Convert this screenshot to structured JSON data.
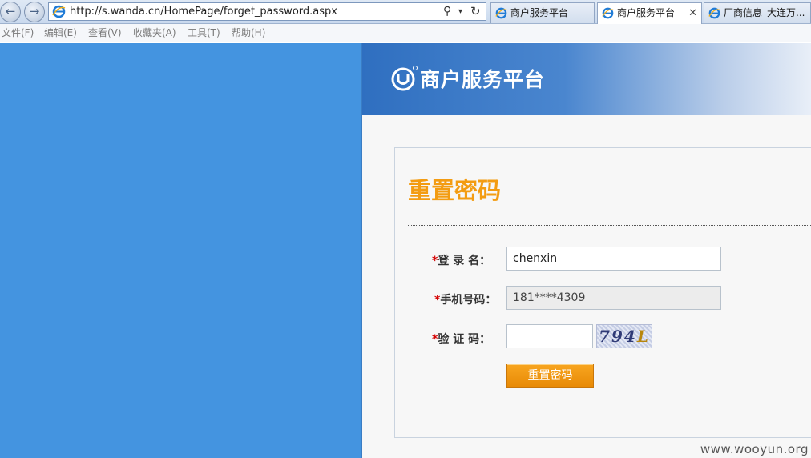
{
  "browser": {
    "address_url": "http://s.wanda.cn/HomePage/forget_password.aspx",
    "tabs": [
      {
        "label": "商户服务平台",
        "active": false
      },
      {
        "label": "商户服务平台",
        "active": true
      },
      {
        "label": "厂商信息_大连万...",
        "active": false
      }
    ],
    "menu": [
      "文件(F)",
      "编辑(E)",
      "查看(V)",
      "收藏夹(A)",
      "工具(T)",
      "帮助(H)"
    ]
  },
  "header": {
    "logo_text": "商户服务平台"
  },
  "form": {
    "title": "重置密码",
    "username": {
      "required_mark": "*",
      "label": "登 录 名：",
      "value": "chenxin"
    },
    "phone": {
      "required_mark": "*",
      "label": "手机号码：",
      "value": "181****4309"
    },
    "captcha": {
      "required_mark": "*",
      "label": "验 证 码：",
      "value": "",
      "image_text": "794",
      "image_text_last": "L"
    },
    "submit_label": "重置密码"
  },
  "watermark": "www.wooyun.org",
  "colors": {
    "left_panel": "#4494e0",
    "title_orange": "#f39c12",
    "button_orange": "#f39c12",
    "required": "#d40000"
  }
}
